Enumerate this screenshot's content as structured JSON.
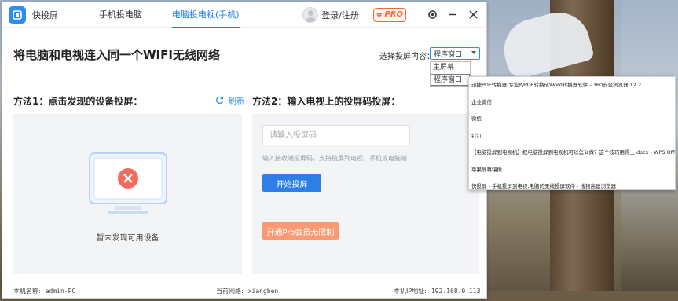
{
  "window": {
    "app_name": "快投屏",
    "tabs": [
      {
        "label": "手机投电脑"
      },
      {
        "label": "电脑投电视(手机)"
      }
    ],
    "login_label": "登录/注册",
    "pro_label": "PRO"
  },
  "headline": "将电脑和电视连入同一个WIFI无线网络",
  "mode": {
    "label": "选择投屏内容：",
    "selected": "程序窗口",
    "options": [
      "主屏幕",
      "程序窗口"
    ]
  },
  "method1": {
    "title": "方法1：点击发现的设备投屏：",
    "refresh_label": "刷新",
    "empty_text": "暂未发现可用设备"
  },
  "method2": {
    "title": "方法2：输入电视上的投屏码投屏：",
    "input_placeholder": "请输入投屏码",
    "hint": "输入接收端投屏码，支持投屏到电视、手机或电脑端",
    "start_label": "开始投屏",
    "pro_button_label": "开通Pro会员无限制"
  },
  "status": {
    "pc_name_label": "本机名称:",
    "pc_name": "admin-PC",
    "network_label": "当前网络:",
    "network": "xiangben",
    "ip_label": "本机IP地址:",
    "ip": "192.168.0.113"
  },
  "window_list": [
    "迅捷PDF转换器|专业的PDF转换成Word转换器软件 - 360安全浏览器 12.2",
    "企业微信",
    "微信",
    "钉钉",
    "【电脑投屏到电视机】把电脑投屏到电视机可以怎么做？这个技巧用得上.docx - WPS Office",
    "苹果屏幕镜像",
    "快投屏 - 手机投屏到电视,电脑的无线投屏软件 - 搜狗高速浏览器"
  ],
  "colors": {
    "accent": "#2d8cf0",
    "start_button": "#2d7fe6",
    "pro_orange": "#f06a3a",
    "pro_button": "#fa9a73",
    "error_red": "#f26b5b"
  },
  "icons": [
    "app-logo-icon",
    "user-avatar-icon",
    "diamond-icon",
    "settings-icon",
    "minimize-icon",
    "close-icon",
    "refresh-icon",
    "monitor-error-icon"
  ]
}
